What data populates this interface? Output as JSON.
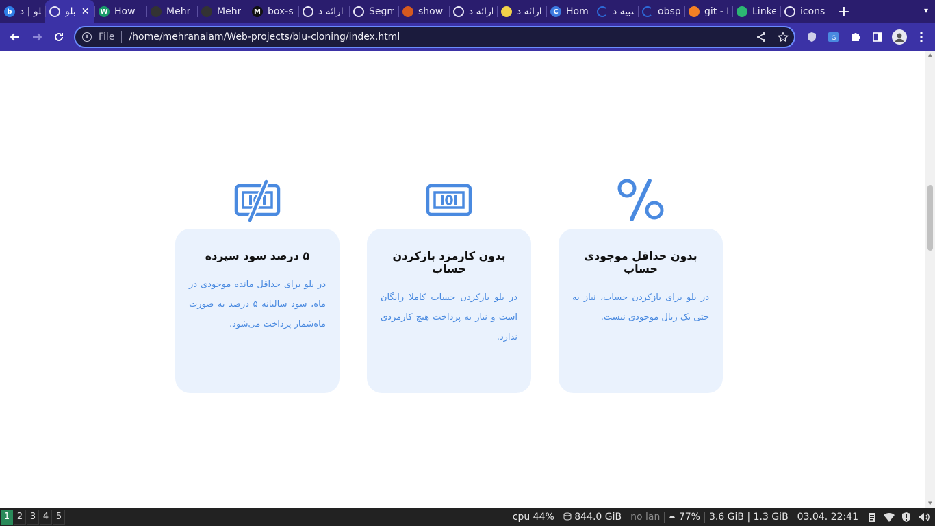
{
  "browser": {
    "tabs": [
      {
        "title": "بلو | د",
        "favicon_color": "#2f7fe8",
        "favicon_glyph": "b",
        "active": false
      },
      {
        "title": "بلو",
        "favicon_color": "#8a8fae",
        "favicon_glyph": "globe",
        "active": true
      },
      {
        "title": "How",
        "favicon_color": "#1a9b6a",
        "favicon_glyph": "W",
        "active": false
      },
      {
        "title": "Mehr",
        "favicon_color": "#333333",
        "favicon_glyph": "github",
        "active": false
      },
      {
        "title": "Mehr",
        "favicon_color": "#333333",
        "favicon_glyph": "github",
        "active": false
      },
      {
        "title": "box-s",
        "favicon_color": "#111111",
        "favicon_glyph": "M",
        "active": false
      },
      {
        "title": "ارائه د",
        "favicon_color": "#8a8fae",
        "favicon_glyph": "globe",
        "active": false
      },
      {
        "title": "Segm",
        "favicon_color": "#8a8fae",
        "favicon_glyph": "globe",
        "active": false
      },
      {
        "title": "show",
        "favicon_color": "#d55a1f",
        "favicon_glyph": "ddg",
        "active": false
      },
      {
        "title": "ارائه د",
        "favicon_color": "#8a8fae",
        "favicon_glyph": "globe",
        "active": false
      },
      {
        "title": "ارائه د",
        "favicon_color": "#f2d24a",
        "favicon_glyph": "note",
        "active": false
      },
      {
        "title": "Hom",
        "favicon_color": "#3d7be0",
        "favicon_glyph": "C",
        "active": false
      },
      {
        "title": "شبیه د",
        "favicon_color": "#2d6ad8",
        "favicon_glyph": "loader",
        "active": false
      },
      {
        "title": "obsp",
        "favicon_color": "#2d6ad8",
        "favicon_glyph": "loader",
        "active": false
      },
      {
        "title": "git - H",
        "favicon_color": "#f48024",
        "favicon_glyph": "so",
        "active": false
      },
      {
        "title": "Linke",
        "favicon_color": "#2cb673",
        "favicon_glyph": "grid",
        "active": false
      },
      {
        "title": "icons",
        "favicon_color": "#8a8fae",
        "favicon_glyph": "globe",
        "active": false
      }
    ],
    "omnibox": {
      "scheme_label": "File",
      "url": "/home/mehranalam/Web-projects/blu-cloning/index.html"
    }
  },
  "features": [
    {
      "icon": "percent-icon",
      "title": "بدون حداقل موجودی حساب",
      "description": "در بلو برای بازکردن حساب، نیاز به حتی یک ریال موجودی نیست."
    },
    {
      "icon": "banknote-icon",
      "title": "بدون کارمزد بازکردن حساب",
      "description": "در بلو بازکردن حساب کاملا رایگان است و نیاز به پرداخت هیچ کارمزدی ندارد."
    },
    {
      "icon": "banknote-slash-icon",
      "title": "۵ درصد سود سپرده",
      "description": "در بلو برای حداقل مانده موجودی در ماه، سود سالیانه ۵ درصد به صورت ماه‌شمار پرداخت می‌شود."
    }
  ],
  "colors": {
    "accent": "#4a8ae0",
    "card_bg": "#eaf2fd",
    "tabbar_bg": "#2a1d6e",
    "toolbar_bg": "#3b32a6"
  },
  "taskbar": {
    "workspaces": [
      "1",
      "2",
      "3",
      "4",
      "5"
    ],
    "active_workspace": "1",
    "cpu": "cpu  44%",
    "disk": "844.0 GiB",
    "network": "no lan",
    "battery": "77%",
    "memory": "3.6 GiB | 1.3 GiB",
    "datetime": "03.04. 22:41"
  }
}
